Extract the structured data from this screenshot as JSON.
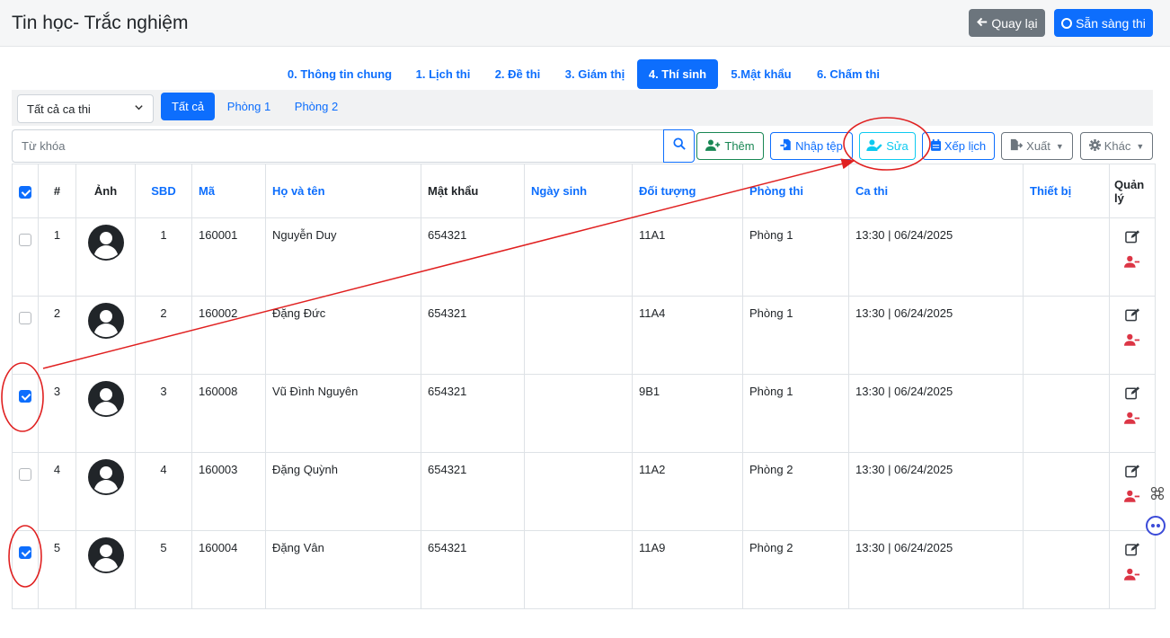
{
  "header": {
    "title": "Tin học- Trắc nghiệm",
    "back_label": "Quay lại",
    "ready_label": "Sẵn sàng thi"
  },
  "tabs": [
    {
      "label": "0. Thông tin chung",
      "active": false
    },
    {
      "label": "1. Lịch thi",
      "active": false
    },
    {
      "label": "2. Đề thi",
      "active": false
    },
    {
      "label": "3. Giám thị",
      "active": false
    },
    {
      "label": "4. Thí sinh",
      "active": true
    },
    {
      "label": "5.Mật khẩu",
      "active": false
    },
    {
      "label": "6. Chấm thi",
      "active": false
    }
  ],
  "filter": {
    "session_select": "Tất cả ca thi",
    "rooms": [
      {
        "label": "Tất cả",
        "active": true
      },
      {
        "label": "Phòng 1",
        "active": false
      },
      {
        "label": "Phòng 2",
        "active": false
      }
    ]
  },
  "search": {
    "placeholder": "Từ khóa",
    "value": ""
  },
  "toolbar": {
    "add_label": "Thêm",
    "import_label": "Nhập tệp",
    "edit_label": "Sửa",
    "schedule_label": "Xếp lịch",
    "export_label": "Xuất",
    "other_label": "Khác"
  },
  "table": {
    "header_checked": true,
    "columns": {
      "index": "#",
      "photo": "Ảnh",
      "sbd": "SBD",
      "code": "Mã",
      "name": "Họ và tên",
      "password": "Mật khẩu",
      "dob": "Ngày sinh",
      "group": "Đối tượng",
      "room": "Phòng thi",
      "session": "Ca thi",
      "device": "Thiết bị",
      "manage": "Quản lý"
    },
    "rows": [
      {
        "checked": false,
        "index": "1",
        "sbd": "1",
        "code": "160001",
        "name": "Nguyễn Duy",
        "password": "654321",
        "dob": "",
        "group": "11A1",
        "room": "Phòng 1",
        "session": "13:30 | 06/24/2025",
        "device": ""
      },
      {
        "checked": false,
        "index": "2",
        "sbd": "2",
        "code": "160002",
        "name": "Đặng Đức",
        "password": "654321",
        "dob": "",
        "group": "11A4",
        "room": "Phòng 1",
        "session": "13:30 | 06/24/2025",
        "device": ""
      },
      {
        "checked": true,
        "index": "3",
        "sbd": "3",
        "code": "160008",
        "name": "Vũ Đình Nguyên",
        "password": "654321",
        "dob": "",
        "group": "9B1",
        "room": "Phòng 1",
        "session": "13:30 | 06/24/2025",
        "device": ""
      },
      {
        "checked": false,
        "index": "4",
        "sbd": "4",
        "code": "160003",
        "name": "Đặng Quỳnh",
        "password": "654321",
        "dob": "",
        "group": "11A2",
        "room": "Phòng 2",
        "session": "13:30 | 06/24/2025",
        "device": ""
      },
      {
        "checked": true,
        "index": "5",
        "sbd": "5",
        "code": "160004",
        "name": "Đặng Vân",
        "password": "654321",
        "dob": "",
        "group": "11A9",
        "room": "Phòng 2",
        "session": "13:30 | 06/24/2025",
        "device": ""
      }
    ]
  },
  "icons": {
    "back": "arrow-left-icon",
    "ready": "circle-icon",
    "search": "search-icon",
    "add": "user-plus-icon",
    "import": "file-import-icon",
    "edit": "user-edit-icon",
    "schedule": "calendar-icon",
    "export": "file-export-icon",
    "other": "gear-icon",
    "row_edit": "edit-icon",
    "row_remove": "user-minus-icon"
  },
  "colors": {
    "primary": "#0d6efd",
    "secondary": "#6c757d",
    "success": "#198754",
    "info": "#0dcaf0",
    "danger": "#dc3545",
    "annotation": "#e02020"
  }
}
